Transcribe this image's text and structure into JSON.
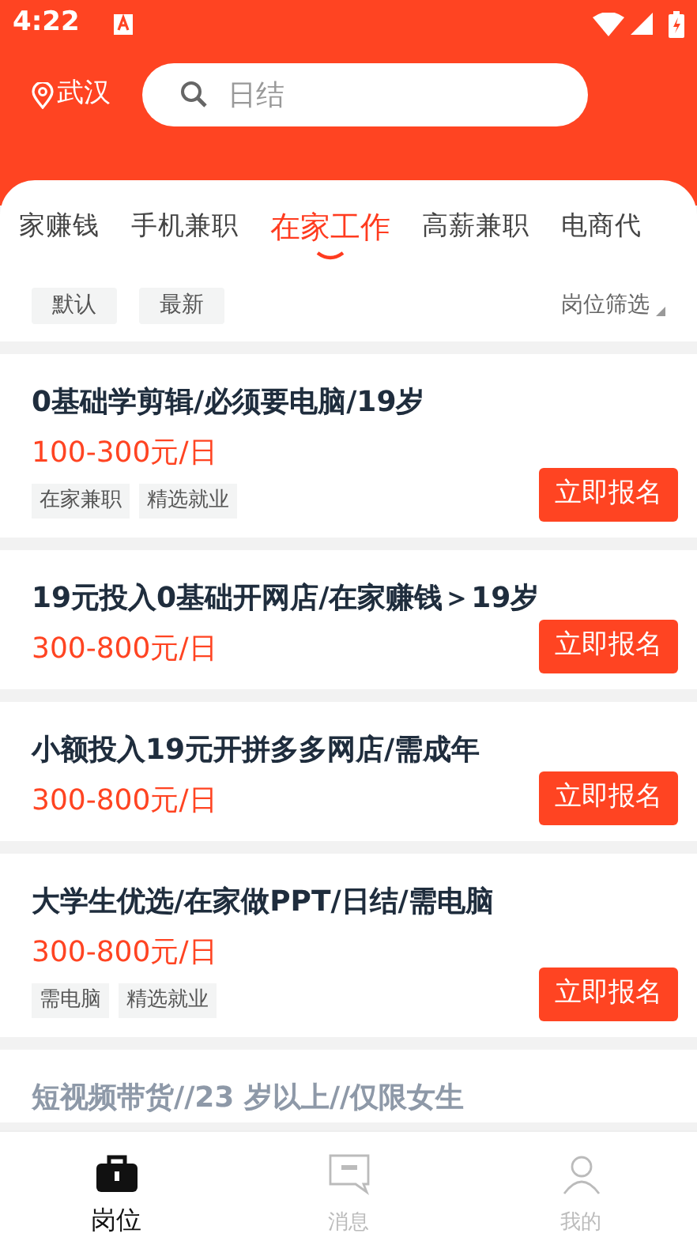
{
  "status_bar": {
    "time": "4:22"
  },
  "header": {
    "city": "武汉",
    "search": {
      "placeholder": "日结"
    }
  },
  "tabs": [
    {
      "label": "家赚钱",
      "selected": false
    },
    {
      "label": "手机兼职",
      "selected": false
    },
    {
      "label": "在家工作",
      "selected": true
    },
    {
      "label": "高薪兼职",
      "selected": false
    },
    {
      "label": "电商代",
      "selected": false
    }
  ],
  "filters": {
    "sorts": [
      "默认",
      "最新"
    ],
    "dropdown": "岗位筛选"
  },
  "jobs": [
    {
      "title": "0基础学剪辑/必须要电脑/19岁",
      "salary": "100-300元/日",
      "tags": [
        "在家兼职",
        "精选就业"
      ],
      "button": "立即报名",
      "dimmed": false
    },
    {
      "title": "19元投入0基础开网店/在家赚钱＞19岁",
      "salary": "300-800元/日",
      "button": "立即报名",
      "dimmed": false
    },
    {
      "title": "小额投入19元开拼多多网店/需成年",
      "salary": "300-800元/日",
      "button": "立即报名",
      "dimmed": false
    },
    {
      "title": "大学生优选/在家做PPT/日结/需电脑",
      "salary": "300-800元/日",
      "tags": [
        "需电脑",
        "精选就业"
      ],
      "button": "立即报名",
      "dimmed": false
    },
    {
      "title": "短视频带货//23 岁以上//仅限女生",
      "dimmed": true
    }
  ],
  "bottom_nav": [
    {
      "label": "岗位",
      "kind": "bag",
      "selected": true
    },
    {
      "label": "消息",
      "kind": "message",
      "selected": false
    },
    {
      "label": "我的",
      "kind": "person",
      "selected": false
    }
  ]
}
